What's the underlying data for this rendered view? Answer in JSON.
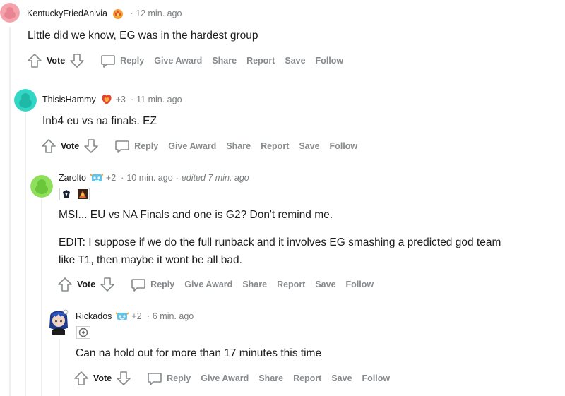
{
  "comments": [
    {
      "author": "KentuckyFriedAnivia",
      "awards": "",
      "time": "12 min. ago",
      "edited": "",
      "paragraphs": [
        "Little did we know, EG was in the hardest group"
      ]
    },
    {
      "author": "ThisisHammy",
      "awards": "+3",
      "time": "11 min. ago",
      "edited": "",
      "paragraphs": [
        "Inb4 eu vs na finals. EZ"
      ]
    },
    {
      "author": "Zarolto",
      "awards": "+2",
      "time": "10 min. ago",
      "edited": "edited 7 min. ago",
      "paragraphs": [
        "MSI... EU vs NA Finals and one is G2? Don't remind me.",
        "EDIT: I suppose if we do the full runback and it involves EG smashing a predicted god team",
        "like T1, then maybe it wont be all bad."
      ]
    },
    {
      "author": "Rickados",
      "awards": "+2",
      "time": "6 min. ago",
      "edited": "",
      "paragraphs": [
        "Can na hold out for more than 17 minutes this time"
      ]
    }
  ],
  "actions": {
    "vote": "Vote",
    "reply": "Reply",
    "give_award": "Give Award",
    "share": "Share",
    "report": "Report",
    "save": "Save",
    "follow": "Follow"
  },
  "separator": "·",
  "colors": {
    "thread_line": "#edeff1",
    "meta": "#787c7e",
    "action": "#878a8c",
    "text": "#1c1c1c"
  },
  "icons": [
    "upvote-icon",
    "downvote-icon",
    "reply-icon",
    "award-flair-icon",
    "snoo-avatar-icon"
  ]
}
